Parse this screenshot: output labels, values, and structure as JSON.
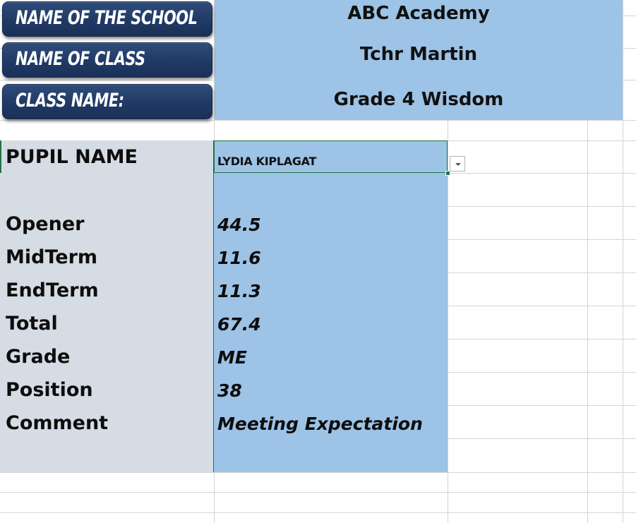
{
  "header": {
    "school_label": "NAME OF  THE SCHOOL",
    "school_value": "ABC Academy",
    "class_label": "NAME OF  CLASS",
    "class_value": "Tchr Martin",
    "classname_label": "CLASS NAME:",
    "classname_value": "Grade 4 Wisdom"
  },
  "pupil": {
    "label": "PUPIL NAME",
    "selected": "LYDIA KIPLAGAT"
  },
  "results": [
    {
      "label": "Opener",
      "value": "44.5"
    },
    {
      "label": "MidTerm",
      "value": "11.6"
    },
    {
      "label": "EndTerm",
      "value": "11.3"
    },
    {
      "label": "Total",
      "value": "67.4"
    },
    {
      "label": "Grade",
      "value": "ME"
    },
    {
      "label": "Position",
      "value": "38"
    },
    {
      "label": "Comment",
      "value": "Meeting Expectation"
    }
  ],
  "colors": {
    "cell_blue": "#9dc3e6",
    "cell_grey": "#d6dce4",
    "header_button": "#1f3864",
    "selection_green": "#217346",
    "gridline": "#d4d4d4"
  }
}
